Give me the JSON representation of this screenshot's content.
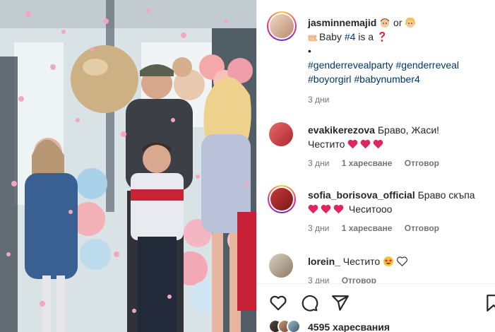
{
  "post": {
    "author": "jasminnemajid",
    "caption_or": "or",
    "caption_line2_pre": "Baby",
    "caption_tag_num": "#4",
    "caption_line2_post": "is a",
    "caption_bullet": "•",
    "hashtags_line1": "#genderrevealparty #genderreveal",
    "hashtags_line2": "#boyorgirl #babynumber4",
    "time": "3 дни"
  },
  "comments": [
    {
      "username": "evakikerezova",
      "text": "Браво, Жаси!",
      "text2": "Честито",
      "time": "3 дни",
      "likes": "1 харесване",
      "reply": "Отговор"
    },
    {
      "username": "sofia_borisova_official",
      "text": "Браво скъпа",
      "text2": "Чеситоoo",
      "time": "3 дни",
      "likes": "1 харесване",
      "reply": "Отговор"
    },
    {
      "username": "lorein_",
      "text": "Честито",
      "time": "3 дни",
      "reply": "Отговор"
    }
  ],
  "footer": {
    "likes_count": "4595 харесвания"
  },
  "icons": {
    "like": "heart-icon",
    "comment": "comment-icon",
    "share": "paper-plane-icon",
    "save": "bookmark-icon"
  },
  "colors": {
    "hashtag": "#00376b",
    "heart_red": "#e0245e",
    "meta_gray": "#737373"
  }
}
